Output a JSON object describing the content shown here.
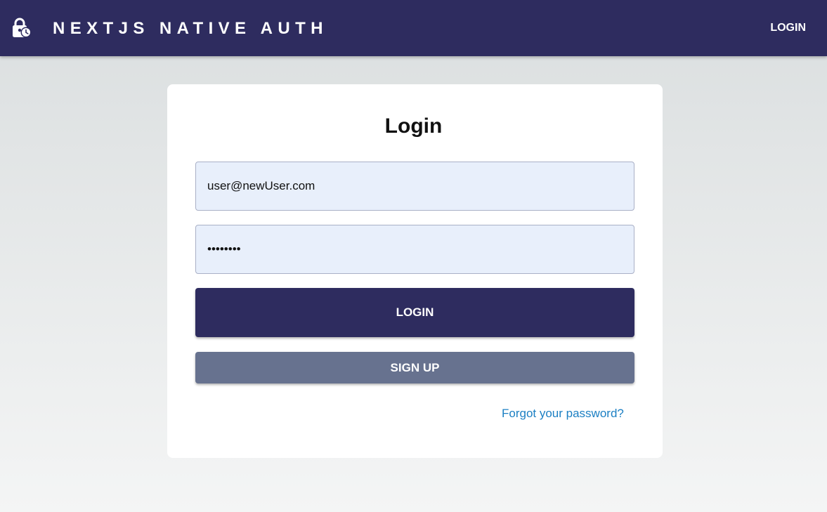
{
  "header": {
    "brand_icon": "lock-clock-icon",
    "title": "NEXTJS NATIVE AUTH",
    "login_link": "LOGIN",
    "background_color": "#2e2c5f"
  },
  "login_form": {
    "title": "Login",
    "email_value": "user@newUser.com",
    "password_value": "••••••••",
    "login_button": "LOGIN",
    "signup_button": "SIGN UP",
    "forgot_password_link": "Forgot your password?",
    "primary_color": "#2e2c5f",
    "secondary_color": "#67728f",
    "link_color": "#1b7fc3"
  }
}
